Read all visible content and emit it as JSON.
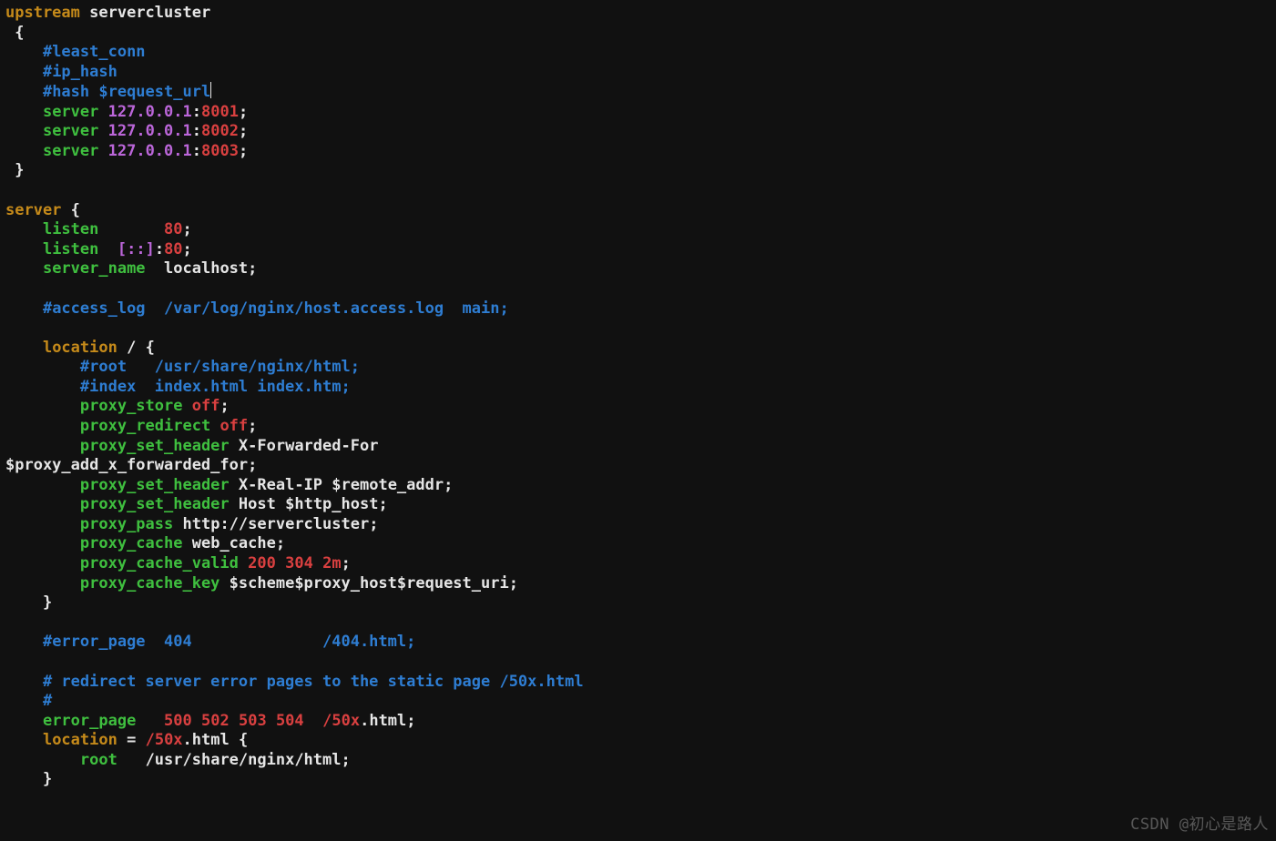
{
  "watermark": "CSDN @初心是路人",
  "t": {
    "upstream": "upstream",
    "name": "servercluster",
    "lbrace": "{",
    "least_conn": "#least_conn",
    "ip_hash": "#ip_hash",
    "hash_req": "#hash $request_url",
    "server": "server",
    "ip": "127.0.0.1",
    "colon": ":",
    "p8001": "8001",
    "p8002": "8002",
    "p8003": "8003",
    "semi": ";",
    "rbrace": "}",
    "server_block": "server {",
    "listen": "listen",
    "eighty": "80",
    "brackets": "[::]",
    "server_name": "server_name",
    "localhost": "localhost;",
    "access_log": "#access_log  /var/log/nginx/host.access.log  main;",
    "location": "location",
    "slash": "/",
    "lbrace2": "{",
    "root_c": "#root   /usr/share/nginx/html;",
    "index_c": "#index  index.html index.htm;",
    "proxy_store": "proxy_store",
    "off": "off",
    "proxy_redirect": "proxy_redirect",
    "proxy_set_header": "proxy_set_header",
    "xff": "X-Forwarded-For",
    "proxy_add_xff": "$proxy_add_x_forwarded_for",
    "x_real_ip": "X-Real-IP",
    "remote_addr": "$remote_addr",
    "host": "Host",
    "http_host": "$http_host",
    "proxy_pass": "proxy_pass",
    "http_sc": "http://servercluster;",
    "proxy_cache": "proxy_cache",
    "web_cache": "web_cache;",
    "proxy_cache_valid": "proxy_cache_valid",
    "v200": "200",
    "v304": "304",
    "v2m": "2m",
    "proxy_cache_key": "proxy_cache_key",
    "scheme": "$scheme$proxy_host$request_uri",
    "error_page_c": "#error_page  404              /404.html;",
    "redirect_c": "# redirect server error pages to the static page /50x.html",
    "hash": "#",
    "error_page": "error_page",
    "e500": "500",
    "e502": "502",
    "e503": "503",
    "e504": "504",
    "slash50x": "/50x",
    "dot_html": ".html;",
    "eq": "=",
    "slash50x2": "/50x",
    "dot_html2": ".html {",
    "root": "root",
    "rootpath": "/usr/share/nginx/html;"
  }
}
